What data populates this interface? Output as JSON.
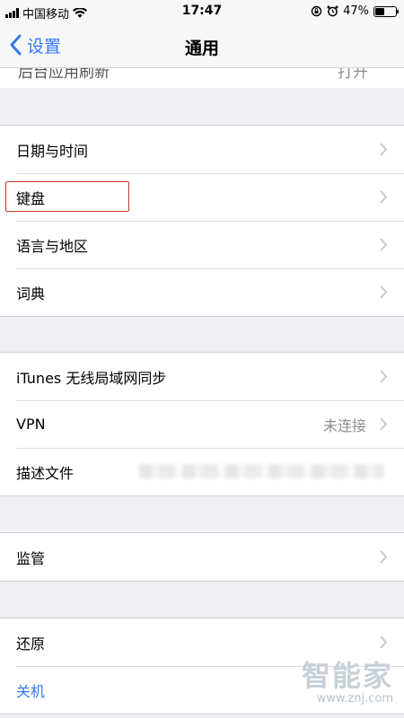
{
  "status_bar": {
    "carrier": "中国移动",
    "time": "17:47",
    "battery": "47%",
    "battery_level": 0.47,
    "icons": [
      "signal-icon",
      "wifi-icon",
      "orientation-lock-icon",
      "alarm-icon",
      "battery-icon"
    ]
  },
  "nav": {
    "back_label": "设置",
    "title": "通用"
  },
  "partial_row": {
    "label": "后台应用刷新",
    "value": "打开"
  },
  "groups": [
    {
      "rows": [
        {
          "label": "日期与时间",
          "value": ""
        },
        {
          "label": "键盘",
          "value": ""
        },
        {
          "label": "语言与地区",
          "value": ""
        },
        {
          "label": "词典",
          "value": ""
        }
      ]
    },
    {
      "rows": [
        {
          "label": "iTunes 无线局域网同步",
          "value": ""
        },
        {
          "label": "VPN",
          "value": "未连接"
        },
        {
          "label": "描述文件",
          "value": ""
        }
      ]
    },
    {
      "rows": [
        {
          "label": "监管",
          "value": ""
        }
      ]
    },
    {
      "rows": [
        {
          "label": "还原",
          "value": ""
        },
        {
          "label": "关机",
          "value": ""
        }
      ]
    }
  ],
  "watermark": {
    "text": "智能家",
    "url": "www.znj.com"
  },
  "colors": {
    "accent": "#3478f6",
    "highlight": "#c0392b",
    "background": "#efeff4"
  }
}
